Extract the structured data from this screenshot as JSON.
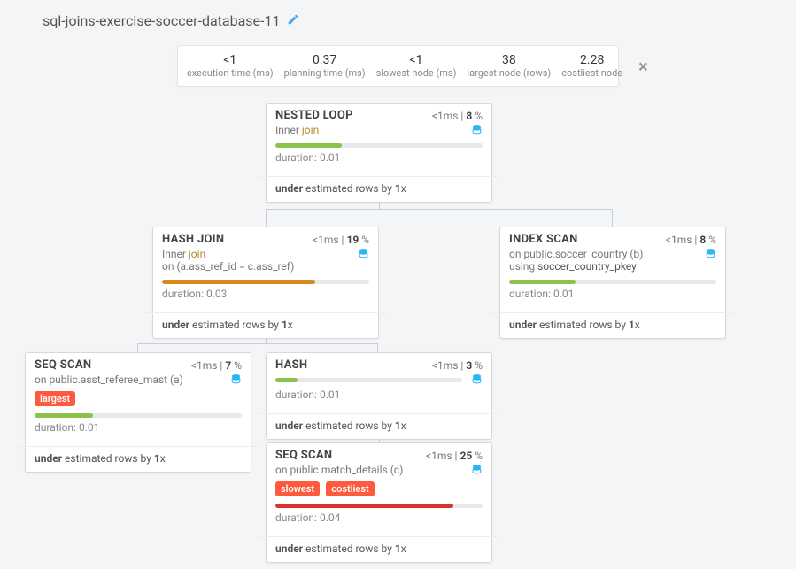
{
  "title": "sql-joins-exercise-soccer-database-11",
  "stats": [
    {
      "value": "<1",
      "label": "execution time (ms)"
    },
    {
      "value": "0.37",
      "label": "planning time (ms)"
    },
    {
      "value": "<1",
      "label": "slowest node (ms)"
    },
    {
      "value": "38",
      "label": "largest node (rows)"
    },
    {
      "value": "2.28",
      "label": "costliest node"
    }
  ],
  "badges": {
    "largest": "largest",
    "slowest": "slowest",
    "costliest": "costliest"
  },
  "nodes": {
    "nested_loop": {
      "title": "NESTED LOOP",
      "time": "<1ms",
      "pct": "8",
      "sub_pre": "Inner",
      "sub_join": " join",
      "bar_pct": 32,
      "bar_color": "#8bc34a",
      "duration": "duration: 0.01",
      "footer_b": "under",
      "footer_mid": " estimated rows by ",
      "footer_x": "1",
      "footer_suf": "x"
    },
    "hash_join": {
      "title": "HASH JOIN",
      "time": "<1ms",
      "pct": "19",
      "sub_pre": "Inner",
      "sub_join": " join",
      "sub_line2": "on (a.ass_ref_id = c.ass_ref)",
      "bar_pct": 74,
      "bar_color": "#d68a1e",
      "duration": "duration: 0.03",
      "footer_b": "under",
      "footer_mid": " estimated rows by ",
      "footer_x": "1",
      "footer_suf": "x"
    },
    "index_scan": {
      "title": "INDEX SCAN",
      "time": "<1ms",
      "pct": "8",
      "sub_line1": "on public.soccer_country (b)",
      "sub_line2_pre": "using ",
      "sub_line2_val": "soccer_country_pkey",
      "bar_pct": 32,
      "bar_color": "#8bc34a",
      "duration": "duration: 0.01",
      "footer_b": "under",
      "footer_mid": " estimated rows by ",
      "footer_x": "1",
      "footer_suf": "x"
    },
    "seq_scan_a": {
      "title": "SEQ SCAN",
      "time": "<1ms",
      "pct": "7",
      "sub_line1": "on public.asst_referee_mast (a)",
      "bar_pct": 28,
      "bar_color": "#8bc34a",
      "duration": "duration: 0.01",
      "footer_b": "under",
      "footer_mid": " estimated rows by ",
      "footer_x": "1",
      "footer_suf": "x"
    },
    "hash": {
      "title": "HASH",
      "time": "<1ms",
      "pct": "3",
      "bar_pct": 12,
      "bar_color": "#8bc34a",
      "duration": "duration: 0.01",
      "footer_b": "under",
      "footer_mid": " estimated rows by ",
      "footer_x": "1",
      "footer_suf": "x"
    },
    "seq_scan_c": {
      "title": "SEQ SCAN",
      "time": "<1ms",
      "pct": "25",
      "sub_line1": "on public.match_details (c)",
      "bar_pct": 86,
      "bar_color": "#d9342b",
      "duration": "duration: 0.04",
      "footer_b": "under",
      "footer_mid": " estimated rows by ",
      "footer_x": "1",
      "footer_suf": "x"
    }
  }
}
